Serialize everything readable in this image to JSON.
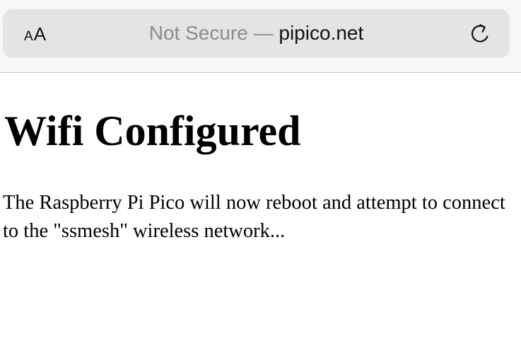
{
  "browser": {
    "text_size_button": {
      "small": "A",
      "large": "A"
    },
    "address": {
      "security": "Not Secure",
      "separator": " — ",
      "domain": "pipico.net"
    },
    "reload_icon": "reload-icon"
  },
  "page": {
    "title": "Wifi Configured",
    "message": "The Raspberry Pi Pico will now reboot and attempt to connect to the \"ssmesh\" wireless network..."
  },
  "colors": {
    "chrome_background": "#f7f7f7",
    "address_bar_background": "#e4e4e4",
    "security_text": "#8c8c8c",
    "text": "#111111"
  }
}
